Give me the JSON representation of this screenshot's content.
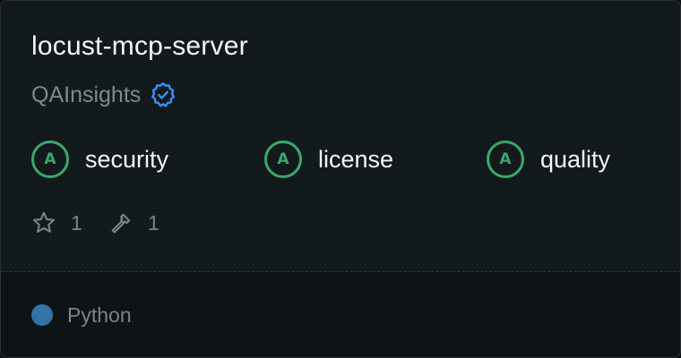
{
  "server": {
    "name": "locust-mcp-server",
    "owner": "QAInsights",
    "owner_verified_icon": "verified-badge-icon"
  },
  "scores": [
    {
      "grade": "A",
      "label": "security"
    },
    {
      "grade": "A",
      "label": "license"
    },
    {
      "grade": "A",
      "label": "quality"
    }
  ],
  "stats": {
    "stars": "1",
    "star_icon": "star-icon",
    "tools": "1",
    "tools_icon": "hammer-icon"
  },
  "language": {
    "name": "Python",
    "color": "#3572A5"
  },
  "colors": {
    "grade_green": "#3ba86b",
    "verified_blue": "#3b8ef0"
  }
}
